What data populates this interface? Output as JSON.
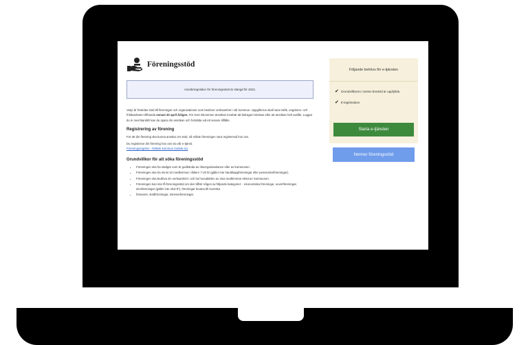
{
  "page": {
    "title": "Föreningsstöd",
    "notice": "Ansökningstiden för föreningsstöd är stängd för 2022.",
    "intro": {
      "part1": "Varje år fördelas stöd till föreningar och organisationer som bedriver verksamhet i vår kommun. Uppgifterna skall vara trafik, ungdoms- och fritidsarbeten tillhanda ",
      "bold": "senast 30 april årligen.",
      "part2": " För sent inkommen ansökan innebär att bidraget minskas eller att ansökan helt avslås. Loggar du in med BankID kan du spara din ansökan och fortsätta vid ett senare tillfälle."
    },
    "registration": {
      "heading": "Registrering av förening",
      "text1": "För att din förening ska kunna ansöka om stöd, så måste föreningen vara registrerad hos oss.",
      "text2": "Du registrerar din förening hos oss via vår e-tjänst.",
      "link": "Föreningsregister - Rättvik kommun (rattvik.se)"
    },
    "criteria": {
      "heading": "Grundvillkor för att söka föreningsstöd",
      "items": [
        "Föreningen ska ha stadgar som är godkända av riksorganisationen eller av kommunen.",
        "Föreningen ska ha minst 10 medlemmar i åldern 7-20 år (gäller inte handikappföreningar eller pensionärsföreningar).",
        "Föreningen ska bedriva sin verksamhet i och ha huvuddelen av sina medlemmar skrivna i kommunen.",
        "Föreningen kan inte få föreningsstöd om den tillhör någon av följande kategorier: - ekonomiska föreningar, ouverföreningar, elevföreningar (gäller inte skol-IF), föreningar knutna till svenska",
        "försvaret, stödföreningar, intresseföreningar."
      ]
    }
  },
  "sidebar": {
    "heading": "Följande behövs för e-tjänsten",
    "requirements": [
      "Grundvillkoren i texten bredvid är uppfyllda",
      "E-legitimation"
    ],
    "check_glyph": "✔",
    "start_button": "Starta e-tjänsten"
  },
  "norms_button": "Normer föreningsstöd",
  "colors": {
    "accent_green": "#3e8a3d",
    "accent_blue": "#6f9ceb",
    "sidebar_bg": "#f6f0dc",
    "notice_bg": "#eef1fb"
  }
}
